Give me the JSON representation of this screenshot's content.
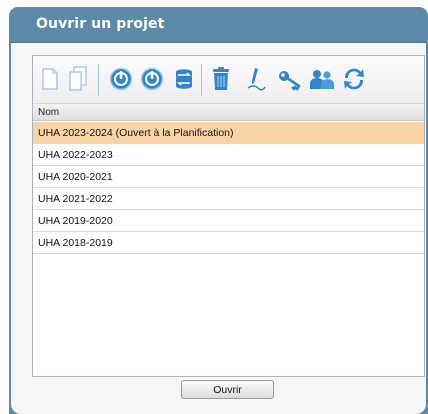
{
  "dialog": {
    "title": "Ouvrir un projet"
  },
  "toolbar": {
    "icons": [
      "new-document-icon",
      "copy-document-icon",
      "power-on-icon",
      "power-off-icon",
      "database-transfer-icon",
      "trash-icon",
      "pencil-icon",
      "key-icon",
      "users-icon",
      "refresh-icon"
    ]
  },
  "table": {
    "column_header": "Nom",
    "rows": [
      {
        "name": "UHA 2023-2024 (Ouvert à la Planification)",
        "selected": true
      },
      {
        "name": "UHA 2022-2023",
        "selected": false
      },
      {
        "name": "UHA 2020-2021",
        "selected": false
      },
      {
        "name": "UHA 2021-2022",
        "selected": false
      },
      {
        "name": "UHA 2019-2020",
        "selected": false
      },
      {
        "name": "UHA 2018-2019",
        "selected": false
      }
    ]
  },
  "footer": {
    "open_label": "Ouvrir"
  },
  "colors": {
    "title_bar": "#5d8aa8",
    "selected_row": "#fad3a6",
    "icon_blue": "#2f86c9"
  }
}
